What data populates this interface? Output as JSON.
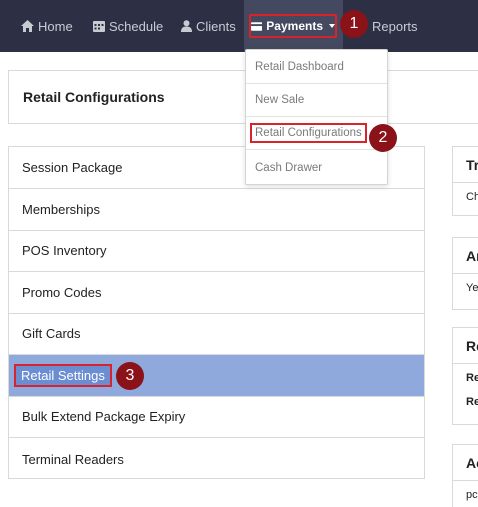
{
  "nav": {
    "items": [
      {
        "label": "Home"
      },
      {
        "label": "Schedule"
      },
      {
        "label": "Clients"
      },
      {
        "label": "Payments"
      },
      {
        "label": "Reports"
      }
    ]
  },
  "dropdown": {
    "items": [
      {
        "label": "Retail Dashboard"
      },
      {
        "label": "New Sale"
      },
      {
        "label": "Retail Configurations"
      },
      {
        "label": "Cash Drawer"
      }
    ]
  },
  "header": {
    "title": "Retail Configurations"
  },
  "config_list": {
    "items": [
      {
        "label": "Session Package"
      },
      {
        "label": "Memberships"
      },
      {
        "label": "POS Inventory"
      },
      {
        "label": "Promo Codes"
      },
      {
        "label": "Gift Cards"
      },
      {
        "label": "Retail Settings"
      },
      {
        "label": "Bulk Extend Package Expiry"
      },
      {
        "label": "Terminal Readers"
      }
    ]
  },
  "right_panels": [
    {
      "title": "Tr",
      "lines": [
        "Ch"
      ]
    },
    {
      "title": "Ar",
      "lines": [
        "Ye"
      ]
    },
    {
      "title": "Re",
      "lines": [
        "Re",
        "Re"
      ]
    },
    {
      "title": "Ac",
      "lines": [
        "pc"
      ]
    }
  ],
  "annotations": {
    "step1": "1",
    "step2": "2",
    "step3": "3"
  },
  "colors": {
    "nav_bg": "#2d3045",
    "highlight_red": "#d9232b",
    "active_row": "#8fa9dc",
    "badge": "#8b1218"
  }
}
